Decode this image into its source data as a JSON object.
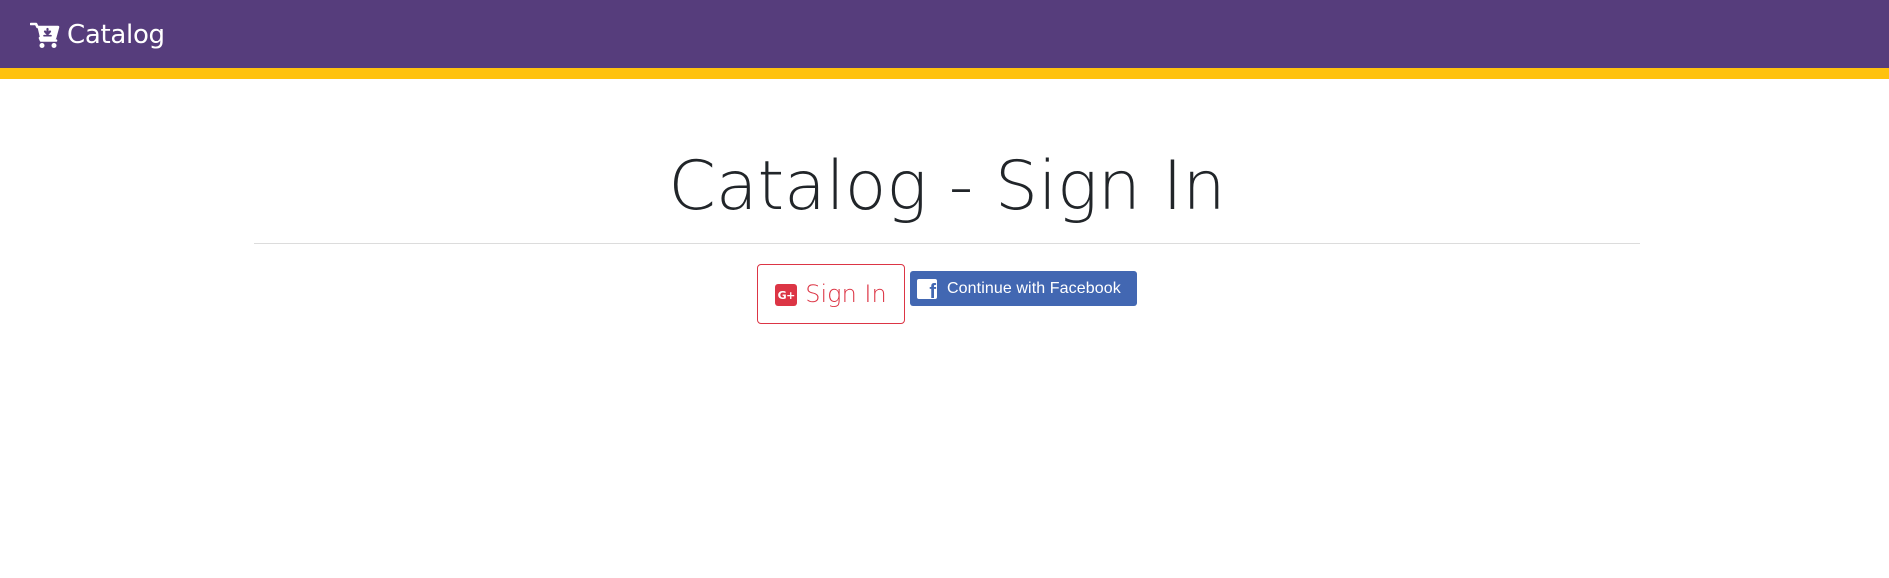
{
  "navbar": {
    "brand_label": "Catalog",
    "brand_icon": "shopping-cart-download-icon",
    "background_color": "#563d7c",
    "accent_color": "#ffc20e"
  },
  "main": {
    "title": "Catalog - Sign In",
    "google_button": {
      "label": "Sign In",
      "icon": "google-plus-icon",
      "icon_text": "G+",
      "color": "#dc3545"
    },
    "facebook_button": {
      "label": "Continue with Facebook",
      "icon": "facebook-icon",
      "icon_text": "f",
      "color": "#4267b2"
    }
  }
}
